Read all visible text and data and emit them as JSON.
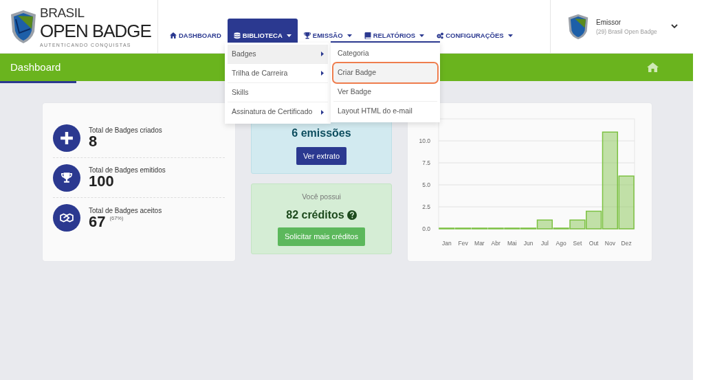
{
  "brand": {
    "line_1": "BRASIL",
    "line_2": "OPEN BADGE",
    "tagline": "AUTENTICANDO CONQUISTAS"
  },
  "nav": [
    {
      "label": "DASHBOARD",
      "dropdown": false,
      "selected": false
    },
    {
      "label": "BIBLIOTECA",
      "dropdown": true,
      "selected": true
    },
    {
      "label": "EMISSÃO",
      "dropdown": true,
      "selected": false
    },
    {
      "label": "RELATÓRIOS",
      "dropdown": true,
      "selected": false
    },
    {
      "label": "CONFIGURAÇÕES",
      "dropdown": true,
      "selected": false
    }
  ],
  "user": {
    "role": "Emissor",
    "organization": "(29) Brasil Open Badge"
  },
  "page_title": "Dashboard",
  "menu": [
    {
      "label": "Badges",
      "submenu": true,
      "selected": true
    },
    {
      "label": "Trilha de Carreira",
      "submenu": true,
      "selected": false
    },
    {
      "label": "Skills",
      "submenu": false,
      "selected": false
    },
    {
      "label": "Assinatura de Certificado",
      "submenu": true,
      "selected": false
    }
  ],
  "submenu": [
    {
      "label": "Categoria",
      "selected": false
    },
    {
      "label": "Criar Badge",
      "selected": true
    },
    {
      "label": "Ver Badge",
      "selected": false
    },
    {
      "label": "Layout HTML do e-mail",
      "selected": false
    }
  ],
  "stats": [
    {
      "label": "Total de Badges criados",
      "value": "8"
    },
    {
      "label": "Total de Badges emitidos",
      "value": "100"
    },
    {
      "label": "Total de Badges aceitos",
      "value": "67",
      "note": "(67%)"
    }
  ],
  "emissions": {
    "value": "6 emissões",
    "button": "Ver extrato"
  },
  "credits": {
    "caption": "Você possui",
    "value": "82 créditos",
    "button": "Solicitar mais créditos"
  },
  "chart": {
    "chart_data": {
      "type": "bar",
      "categories": [
        "Jan",
        "Fev",
        "Mar",
        "Abr",
        "Mai",
        "Jun",
        "Jul",
        "Ago",
        "Set",
        "Out",
        "Nov",
        "Dez"
      ],
      "grid": true,
      "series": [
        {
          "color": "#7cc142",
          "values": [
            0,
            0,
            0,
            0,
            0,
            0,
            1,
            0,
            1,
            2,
            11,
            6
          ]
        }
      ],
      "ylim": [
        0,
        12.5
      ],
      "yticks": [
        {
          "value": 0,
          "label": "0.0"
        },
        {
          "value": 2.5,
          "label": "2.5"
        },
        {
          "value": 5,
          "label": "5.0"
        },
        {
          "value": 7.5,
          "label": "7.5"
        },
        {
          "value": 10,
          "label": "10.0"
        }
      ]
    }
  }
}
